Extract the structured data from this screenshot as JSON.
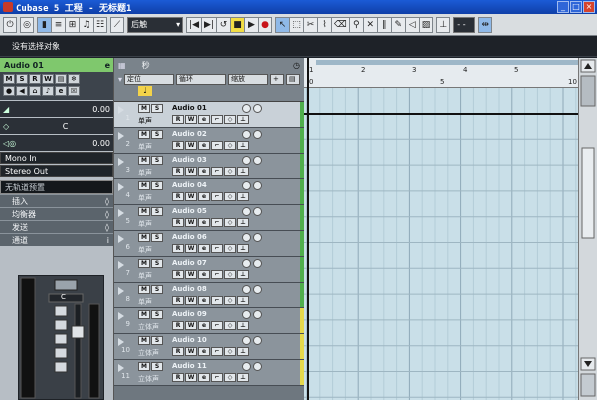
{
  "window": {
    "title": "Cubase 5 工程 - 无标题1",
    "controls": [
      "_",
      "□",
      "×"
    ]
  },
  "toolbar": {
    "automation_mode": "后触",
    "transport": {
      "go_start": "|◀",
      "cycle": "◆",
      "stop": "■",
      "play": "▶",
      "record": "●"
    },
    "snap_value": "- -"
  },
  "status": {
    "message": "没有选择对象"
  },
  "inspector": {
    "track_name": "Audio 01",
    "volume_value": "0.00",
    "pan_label": "C",
    "delay_value": "0.00",
    "input": "Mono In",
    "output": "Stereo Out",
    "preset": "无轨道预置",
    "sections": [
      "插入",
      "均衡器",
      "发送",
      "通道"
    ],
    "channel_label": "C"
  },
  "tracklist": {
    "header_bar": "秒",
    "timebase": "定位",
    "loop_mode": "循环",
    "scroll_mode": "缩放",
    "tracks": [
      {
        "num": "1",
        "name": "Audio 01",
        "channel": "单声",
        "color": "green",
        "selected": true
      },
      {
        "num": "2",
        "name": "Audio 02",
        "channel": "单声",
        "color": "green",
        "selected": false
      },
      {
        "num": "3",
        "name": "Audio 03",
        "channel": "单声",
        "color": "green",
        "selected": false
      },
      {
        "num": "4",
        "name": "Audio 04",
        "channel": "单声",
        "color": "green",
        "selected": false
      },
      {
        "num": "5",
        "name": "Audio 05",
        "channel": "单声",
        "color": "green",
        "selected": false
      },
      {
        "num": "6",
        "name": "Audio 06",
        "channel": "单声",
        "color": "green",
        "selected": false
      },
      {
        "num": "7",
        "name": "Audio 07",
        "channel": "单声",
        "color": "green",
        "selected": false
      },
      {
        "num": "8",
        "name": "Audio 08",
        "channel": "单声",
        "color": "green",
        "selected": false
      },
      {
        "num": "9",
        "name": "Audio 09",
        "channel": "立体声",
        "color": "yellow",
        "selected": false
      },
      {
        "num": "10",
        "name": "Audio 10",
        "channel": "立体声",
        "color": "yellow",
        "selected": false
      },
      {
        "num": "11",
        "name": "Audio 11",
        "channel": "立体声",
        "color": "yellow",
        "selected": false
      }
    ]
  },
  "ruler": {
    "bars": [
      "1",
      "2",
      "3",
      "4",
      "5"
    ],
    "seconds": [
      "0",
      "5",
      "10"
    ]
  },
  "colors": {
    "track_green": "#4fae4c",
    "track_yellow": "#e5d84b",
    "inspector_header": "#7fc86d",
    "title_bar": "#1b5bd6"
  }
}
